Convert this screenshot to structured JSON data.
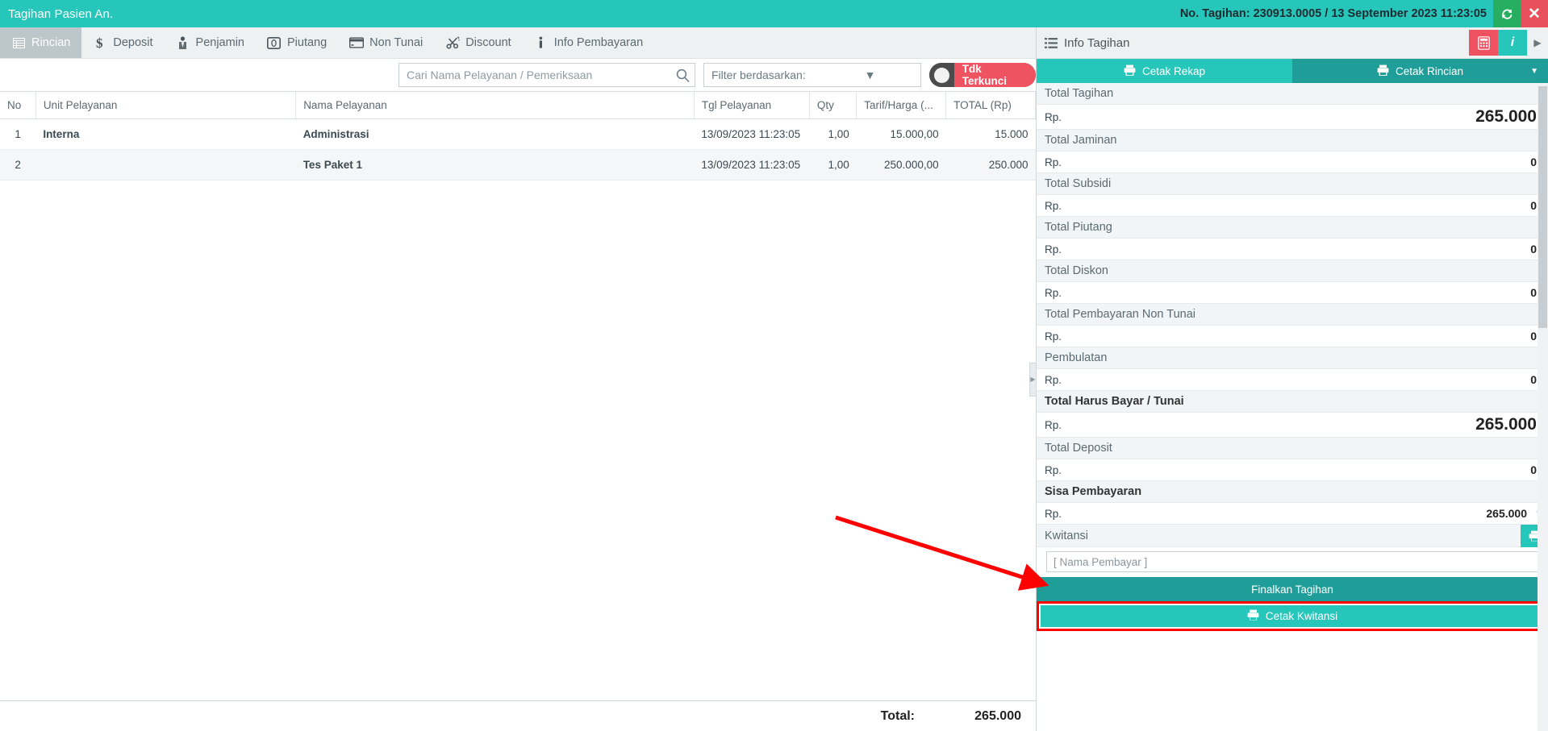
{
  "titlebar": {
    "title": "Tagihan Pasien An.",
    "bill_info": "No. Tagihan: 230913.0005 / 13 September 2023 11:23:05",
    "refresh_icon": "refresh-icon",
    "close_icon": "close-icon",
    "bg_color": "#26c6bb",
    "refresh_color": "#27ae60",
    "close_color": "#e8505b"
  },
  "tabs": [
    {
      "label": "Rincian",
      "icon": "list-grid-icon",
      "active": true
    },
    {
      "label": "Deposit",
      "icon": "dollar-icon",
      "active": false
    },
    {
      "label": "Penjamin",
      "icon": "tie-person-icon",
      "active": false
    },
    {
      "label": "Piutang",
      "icon": "coin-icon",
      "active": false
    },
    {
      "label": "Non Tunai",
      "icon": "credit-card-icon",
      "active": false
    },
    {
      "label": "Discount",
      "icon": "scissors-icon",
      "active": false
    },
    {
      "label": "Info Pembayaran",
      "icon": "info-icon",
      "active": false
    }
  ],
  "toolbar": {
    "search_placeholder": "Cari Nama Pelayanan / Pemeriksaan",
    "search_value": "",
    "search_icon": "search-icon",
    "filter_label": "Filter berdasarkan:",
    "filter_caret": "chevron-down-icon",
    "lock_toggle_label": "Tdk Terkunci",
    "lock_toggle_state": "off",
    "lock_color": "#ef5261"
  },
  "table": {
    "columns": [
      {
        "key": "no",
        "label": "No"
      },
      {
        "key": "unit",
        "label": "Unit Pelayanan"
      },
      {
        "key": "nama",
        "label": "Nama Pelayanan"
      },
      {
        "key": "tgl",
        "label": "Tgl Pelayanan"
      },
      {
        "key": "qty",
        "label": "Qty"
      },
      {
        "key": "tarif",
        "label": "Tarif/Harga (..."
      },
      {
        "key": "total",
        "label": "TOTAL (Rp)"
      }
    ],
    "rows": [
      {
        "no": "1",
        "unit": "Interna",
        "nama": "Administrasi",
        "tgl": "13/09/2023 11:23:05",
        "qty": "1,00",
        "tarif": "15.000,00",
        "total": "15.000"
      },
      {
        "no": "2",
        "unit": "",
        "nama": "Tes Paket 1",
        "tgl": "13/09/2023 11:23:05",
        "qty": "1,00",
        "tarif": "250.000,00",
        "total": "250.000"
      }
    ],
    "footer": {
      "label": "Total:",
      "value": "265.000"
    }
  },
  "right_panel": {
    "header_title": "Info Tagihan",
    "header_menu_icon": "list-lines-icon",
    "calc_icon": "calculator-icon",
    "info_icon": "info-icon",
    "more_icon": "chevron-right-icon",
    "calc_color": "#ef5261",
    "info_color": "#26c6bb",
    "print_tabs": [
      {
        "label": "Cetak Rekap",
        "icon": "printer-icon"
      },
      {
        "label": "Cetak Rincian",
        "icon": "printer-icon",
        "caret": "chevron-down-icon"
      }
    ],
    "items": [
      {
        "label": "Total Tagihan",
        "currency": "Rp.",
        "amount": "265.000",
        "bold": false,
        "big": true,
        "caret": false
      },
      {
        "label": "Total Jaminan",
        "currency": "Rp.",
        "amount": "0",
        "bold": false,
        "big": false,
        "caret": false
      },
      {
        "label": "Total Subsidi",
        "currency": "Rp.",
        "amount": "0",
        "bold": false,
        "big": false,
        "caret": false
      },
      {
        "label": "Total Piutang",
        "currency": "Rp.",
        "amount": "0",
        "bold": false,
        "big": false,
        "caret": false
      },
      {
        "label": "Total Diskon",
        "currency": "Rp.",
        "amount": "0",
        "bold": false,
        "big": false,
        "caret": false
      },
      {
        "label": "Total Pembayaran Non Tunai",
        "currency": "Rp.",
        "amount": "0",
        "bold": false,
        "big": false,
        "caret": false
      },
      {
        "label": "Pembulatan",
        "currency": "Rp.",
        "amount": "0",
        "bold": false,
        "big": false,
        "caret": false
      },
      {
        "label": "Total Harus Bayar / Tunai",
        "currency": "Rp.",
        "amount": "265.000",
        "bold": true,
        "big": true,
        "caret": false
      },
      {
        "label": "Total Deposit",
        "currency": "Rp.",
        "amount": "0",
        "bold": false,
        "big": false,
        "caret": false
      },
      {
        "label": "Sisa Pembayaran",
        "currency": "Rp.",
        "amount": "265.000",
        "bold": true,
        "big": false,
        "caret": true
      }
    ],
    "kwitansi_label": "Kwitansi",
    "kwitansi_print_icon": "printer-icon",
    "payer_placeholder": "[ Nama Pembayar ]",
    "payer_value": "",
    "finalize_label": "Finalkan Tagihan",
    "print_receipt_label": "Cetak Kwitansi",
    "print_receipt_icon": "printer-icon",
    "highlight_color": "#ff0000"
  },
  "annotation": {
    "arrow_color": "#ff0000",
    "arrow": "red-arrow-pointing-to-cetak-kwitansi"
  }
}
